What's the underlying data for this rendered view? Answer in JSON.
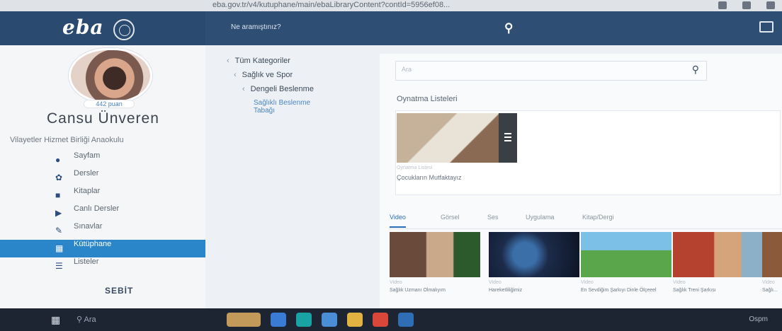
{
  "browser": {
    "url": "eba.gov.tr/v4/kutuphane/main/ebaLibraryContent?contId=5956ef08..."
  },
  "header": {
    "logo": "eba",
    "search_placeholder": "Ne aramıştınız?"
  },
  "profile": {
    "points": "442 puan",
    "name": "Cansu Ünveren",
    "school": "Vilayetler Hizmet Birliği Anaokulu"
  },
  "sidebar": {
    "items": [
      {
        "label": "Sayfam",
        "icon": "person-icon"
      },
      {
        "label": "Dersler",
        "icon": "gear-icon"
      },
      {
        "label": "Kitaplar",
        "icon": "book-icon"
      },
      {
        "label": "Canlı Dersler",
        "icon": "video-icon"
      },
      {
        "label": "Sınavlar",
        "icon": "pencil-icon"
      },
      {
        "label": "Kütüphane",
        "icon": "library-icon",
        "active": true
      },
      {
        "label": "Listeler",
        "icon": "list-icon"
      }
    ],
    "brand": "SEBİT"
  },
  "categories": {
    "all": "Tüm Kategoriler",
    "level1": "Sağlık ve Spor",
    "level2": "Dengeli Beslenme",
    "level3": "Sağlıklı Beslenme Tabağı"
  },
  "content": {
    "search_placeholder": "Ara",
    "playlists_title": "Oynatma Listeleri",
    "playlist": {
      "meta": "Oynatma Listesi",
      "title": "Çocukların Mutfaktayız"
    },
    "tabs": [
      "Video",
      "Görsel",
      "Ses",
      "Uygulama",
      "Kitap/Dergi"
    ],
    "videos": [
      {
        "tag": "Video",
        "title": "Sağlık Uzmanı Olmalıyım"
      },
      {
        "tag": "Video",
        "title": "Hareketliliğimiz"
      },
      {
        "tag": "Video",
        "title": "En Sevdiğim Şarkıyı Dinle Ölçeeel"
      },
      {
        "tag": "Video",
        "title": "Sağlık Treni Şarkısı"
      },
      {
        "tag": "Video",
        "title": "Sağlı..."
      }
    ]
  },
  "taskbar": {
    "search": "Ara",
    "tray": "Ospm"
  },
  "colors": {
    "header": "#2f4e74",
    "active": "#2a86c8",
    "link": "#4c84c4"
  }
}
